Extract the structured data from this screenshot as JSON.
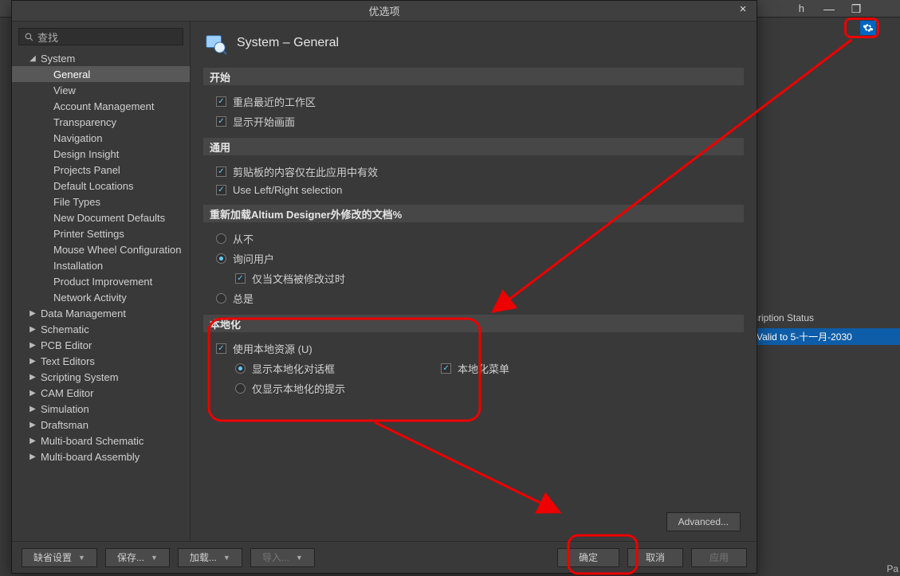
{
  "bg": {
    "top_right_text": "h",
    "subscription_header": "cription Status",
    "subscription_row": "Valid to 5-十一月-2030",
    "bottom_right": "Pa"
  },
  "dialog": {
    "title": "优选项",
    "search_placeholder": "查找",
    "tree": {
      "system": {
        "label": "System",
        "children": [
          "General",
          "View",
          "Account Management",
          "Transparency",
          "Navigation",
          "Design Insight",
          "Projects Panel",
          "Default Locations",
          "File Types",
          "New Document Defaults",
          "Printer Settings",
          "Mouse Wheel Configuration",
          "Installation",
          "Product Improvement",
          "Network Activity"
        ]
      },
      "others": [
        "Data Management",
        "Schematic",
        "PCB Editor",
        "Text Editors",
        "Scripting System",
        "CAM Editor",
        "Simulation",
        "Draftsman",
        "Multi-board Schematic",
        "Multi-board Assembly"
      ]
    },
    "page": {
      "title": "System – General",
      "sections": {
        "start": {
          "header": "开始",
          "opts": [
            "重启最近的工作区",
            "显示开始画面"
          ]
        },
        "general": {
          "header": "通用",
          "opts": [
            "剪贴板的内容仅在此应用中有效",
            "Use Left/Right selection"
          ]
        },
        "reload": {
          "header": "重新加载Altium Designer外修改的文档%",
          "radios": [
            "从不",
            "询问用户",
            "总是"
          ],
          "sub_check": "仅当文档被修改过时"
        },
        "local": {
          "header": "本地化",
          "use_local": "使用本地资源 (U)",
          "radios": [
            "显示本地化对话框",
            "仅显示本地化的提示"
          ],
          "menu_check": "本地化菜单"
        }
      },
      "advanced": "Advanced..."
    },
    "footer": {
      "defaults": "缺省设置",
      "save": "保存...",
      "load": "加载...",
      "import": "导入...",
      "ok": "确定",
      "cancel": "取消",
      "apply": "应用"
    }
  }
}
